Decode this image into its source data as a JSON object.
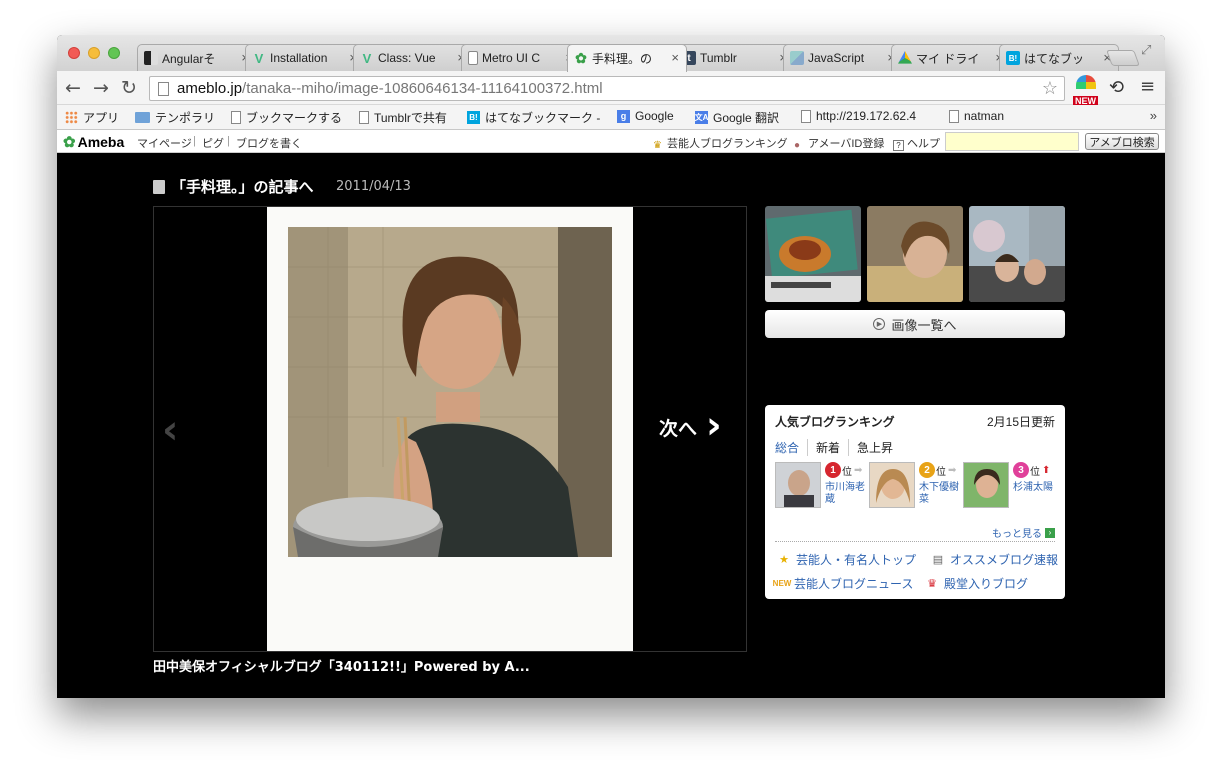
{
  "tabs": [
    {
      "label": "Angularそ",
      "favicon": "angular-icon"
    },
    {
      "label": "Installation",
      "favicon": "vue-icon"
    },
    {
      "label": "Class: Vue",
      "favicon": "vue-icon"
    },
    {
      "label": "Metro UI C",
      "favicon": "page-icon"
    },
    {
      "label": "手料理。の",
      "favicon": "ameba-icon",
      "active": true
    },
    {
      "label": "Tumblr",
      "favicon": "tumblr-icon"
    },
    {
      "label": "JavaScript",
      "favicon": "javascript-icon"
    },
    {
      "label": "マイ ドライ",
      "favicon": "drive-icon"
    },
    {
      "label": "はてなブッ",
      "favicon": "hatena-icon"
    }
  ],
  "tab_close": "×",
  "address": {
    "host": "ameblo.jp",
    "path": "/tanaka--miho/image-10860646134-11164100372.html"
  },
  "ext_badge": "NEW",
  "bookmarks": [
    {
      "label": "アプリ",
      "icon": "apps-icon"
    },
    {
      "label": "テンポラリ",
      "icon": "folder-icon"
    },
    {
      "label": "ブックマークする",
      "icon": "page-icon"
    },
    {
      "label": "Tumblrで共有",
      "icon": "page-icon"
    },
    {
      "label": "はてなブックマーク -",
      "icon": "hatena-icon"
    },
    {
      "label": "Google",
      "icon": "google-icon"
    },
    {
      "label": "Google 翻訳",
      "icon": "translate-icon"
    },
    {
      "label": "http://219.172.62.4",
      "icon": "page-icon"
    },
    {
      "label": "natman",
      "icon": "page-icon"
    }
  ],
  "bookmarks_more": "»",
  "ameba": {
    "logo": "Ameba",
    "links": [
      "マイページ",
      "ピグ",
      "ブログを書く"
    ],
    "ranking_link": "芸能人ブログランキング",
    "register_link": "アメーバID登録",
    "help_link": "ヘルプ",
    "search_button": "アメブロ検索"
  },
  "article": {
    "link_text": "「手料理。」の記事へ",
    "date": "2011/04/13",
    "next_label": "次へ",
    "caption": "田中美保オフィシャルブログ「340112!!」Powered by A..."
  },
  "gallery_button": "画像一覧へ",
  "ranking": {
    "title": "人気ブログランキング",
    "updated": "2月15日更新",
    "tabs": [
      "総合",
      "新着",
      "急上昇"
    ],
    "entries": [
      {
        "rank": "1",
        "suffix": "位",
        "name": "市川海老蔵",
        "badge_color": "#d6262f",
        "trend": "flat"
      },
      {
        "rank": "2",
        "suffix": "位",
        "name": "木下優樹菜",
        "badge_color": "#e8a317",
        "trend": "flat"
      },
      {
        "rank": "3",
        "suffix": "位",
        "name": "杉浦太陽",
        "badge_color": "#e0409a",
        "trend": "up"
      }
    ],
    "more": "もっと見る",
    "links": [
      {
        "label": "芸能人・有名人トップ",
        "icon": "star-icon"
      },
      {
        "label": "オススメブログ速報",
        "icon": "document-icon"
      },
      {
        "label": "芸能人ブログニュース",
        "icon": "new-badge-icon"
      },
      {
        "label": "殿堂入りブログ",
        "icon": "crown-icon"
      }
    ]
  },
  "colors": {
    "link_blue": "#2e63b0",
    "ameba_green": "#3aa04a",
    "page_background": "#000000"
  }
}
